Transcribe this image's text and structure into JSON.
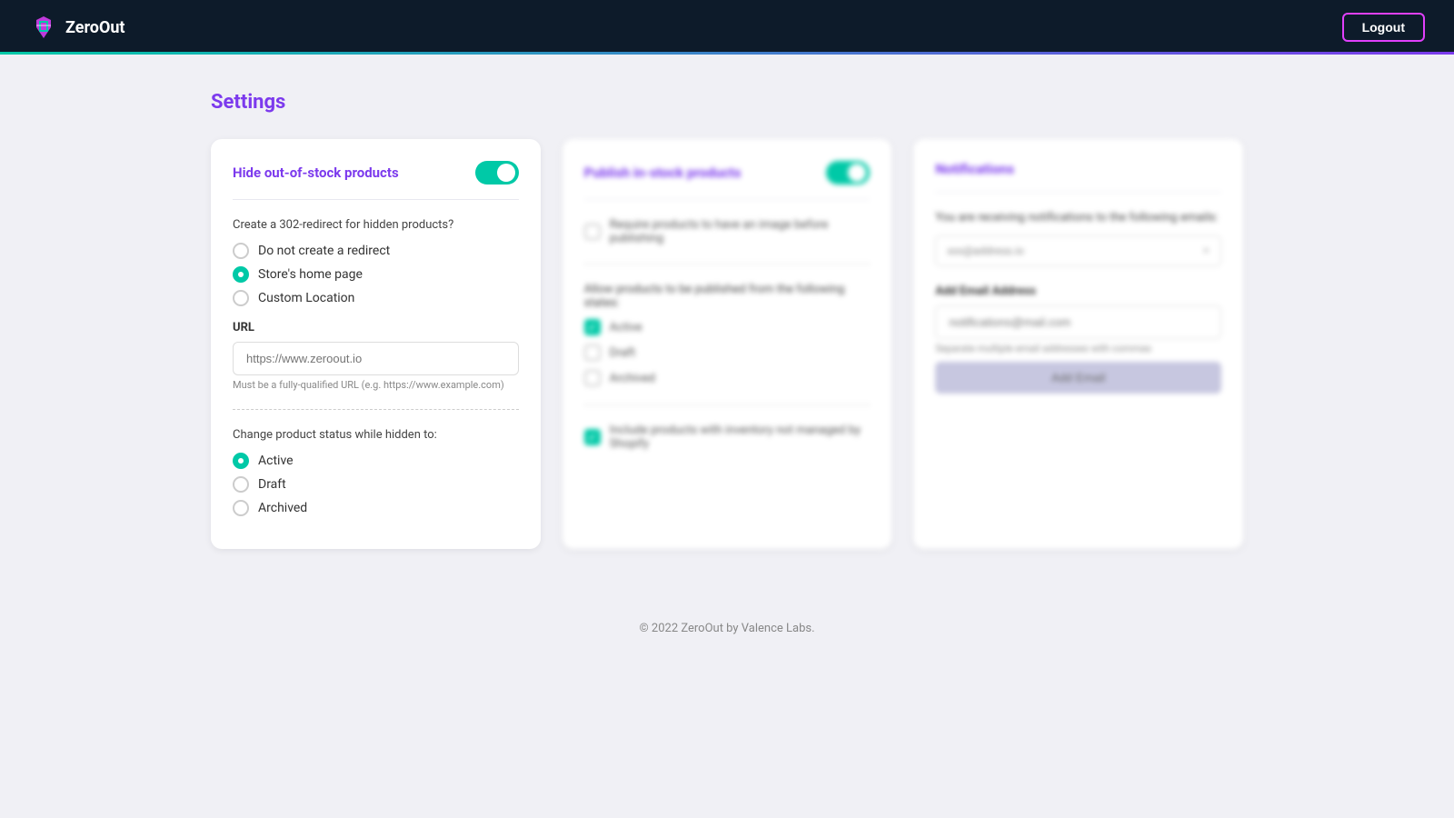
{
  "app": {
    "name": "ZeroOut",
    "logout_label": "Logout"
  },
  "page": {
    "title": "Settings"
  },
  "card1": {
    "title": "Hide out-of-stock products",
    "toggle_on": true,
    "redirect_question": "Create a 302-redirect for hidden products?",
    "redirect_options": [
      {
        "id": "no-redirect",
        "label": "Do not create a redirect",
        "checked": false
      },
      {
        "id": "home-page",
        "label": "Store's home page",
        "checked": true
      },
      {
        "id": "custom-location",
        "label": "Custom Location",
        "checked": false
      }
    ],
    "url_label": "URL",
    "url_placeholder": "https://www.zeroout.io",
    "url_hint": "Must be a fully-qualified URL (e.g. https://www.example.com)",
    "status_label": "Change product status while hidden to:",
    "status_options": [
      {
        "id": "active",
        "label": "Active",
        "checked": true
      },
      {
        "id": "draft",
        "label": "Draft",
        "checked": false
      },
      {
        "id": "archived",
        "label": "Archived",
        "checked": false
      }
    ]
  },
  "card2": {
    "title": "Publish in-stock products",
    "toggle_on": true,
    "require_image_label": "Require products to have an image before publishing",
    "allow_states_label": "Allow products to be published from the following states:",
    "state_options": [
      {
        "id": "active",
        "label": "Active",
        "checked": true
      },
      {
        "id": "draft",
        "label": "Draft",
        "checked": false
      },
      {
        "id": "archived",
        "label": "Archived",
        "checked": false
      }
    ],
    "include_unmanaged_label": "Include products with inventory not managed by Shopify",
    "include_unmanaged_checked": true
  },
  "card3": {
    "title": "Notifications",
    "toggle_on": false,
    "receiving_label": "You are receiving notifications to the following emails:",
    "email_value": "xxx@address.io",
    "add_email_section_label": "Add Email Address",
    "add_email_placeholder": "notifications@mail.com",
    "add_email_hint": "Separate multiple email addresses with commas",
    "add_email_btn_label": "Add Email"
  },
  "footer": {
    "text": "© 2022 ZeroOut by Valence Labs."
  }
}
